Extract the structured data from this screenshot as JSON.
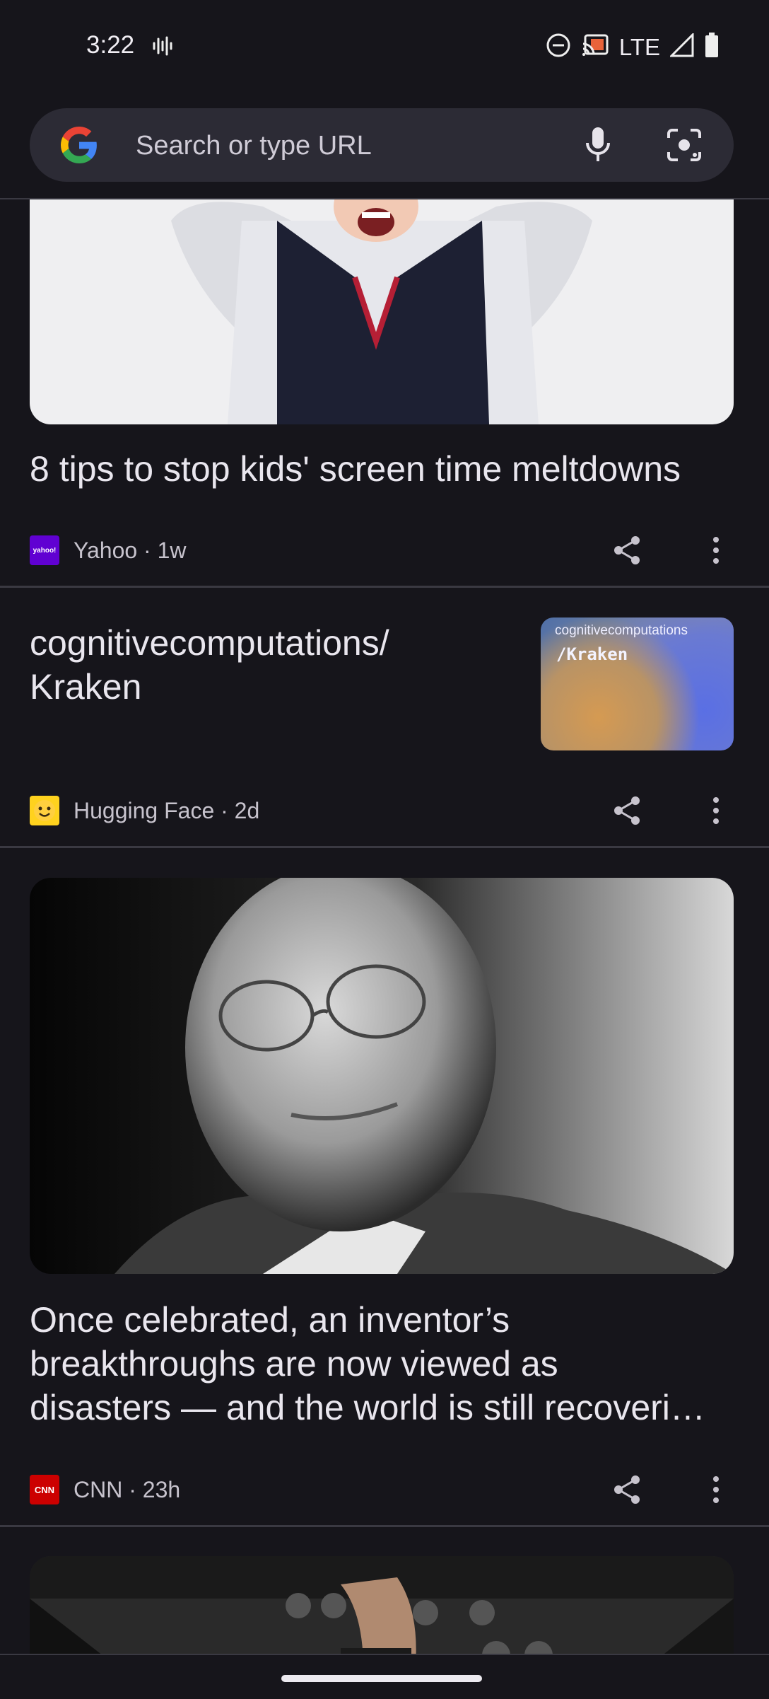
{
  "status_bar": {
    "time": "3:22",
    "network": "LTE",
    "icons": [
      "voicemail-wave-icon",
      "do-not-disturb-icon",
      "cast-icon",
      "signal-icon",
      "battery-icon"
    ]
  },
  "search": {
    "placeholder": "Search or type URL",
    "value": ""
  },
  "feed": {
    "cards": [
      {
        "title": "8 tips to stop kids' screen time meltdowns",
        "publisher": "Yahoo",
        "age": "1w",
        "logo_text": "yahoo!",
        "logo_color": "#6001d2"
      },
      {
        "title_line1": "cognitivecomputations/",
        "title_line2": "Kraken",
        "publisher": "Hugging Face",
        "age": "2d",
        "thumb_owner": "cognitivecomputations",
        "thumb_repo": "/Kraken",
        "logo_color": "#ffd21e"
      },
      {
        "title_line1": "Once celebrated, an inventor’s",
        "title_line2": "breakthroughs are now viewed as",
        "title_line3": "disasters — and the world is still recoveri…",
        "publisher": "CNN",
        "age": "23h",
        "logo_text": "CNN",
        "logo_color": "#cc0000"
      }
    ],
    "meta_separator": " · "
  },
  "colors": {
    "background": "#16151b",
    "search_bar": "#2c2b35",
    "divider": "#3a3942",
    "text": "#e9e6ee"
  }
}
